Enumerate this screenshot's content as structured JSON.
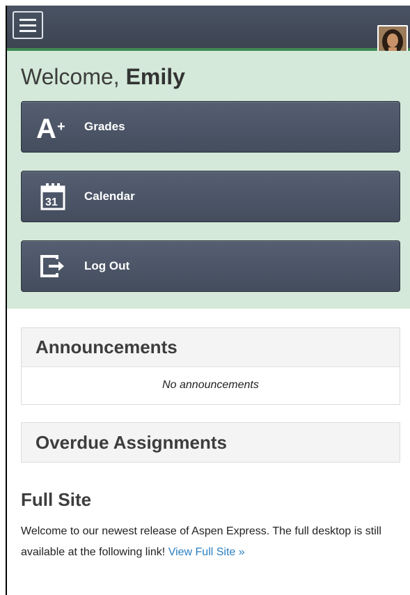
{
  "header": {
    "menu_icon": "hamburger-menu-icon",
    "avatar_icon": "user-avatar"
  },
  "welcome": {
    "greeting": "Welcome,",
    "name": "Emily"
  },
  "nav": [
    {
      "label": "Grades",
      "icon": "grade-a-plus-icon"
    },
    {
      "label": "Calendar",
      "icon": "calendar-icon"
    },
    {
      "label": "Log Out",
      "icon": "log-out-icon"
    }
  ],
  "announcements": {
    "title": "Announcements",
    "empty_text": "No announcements"
  },
  "overdue": {
    "title": "Overdue Assignments"
  },
  "full_site": {
    "title": "Full Site",
    "text": "Welcome to our newest release of Aspen Express. The full desktop is still available at the following link!",
    "link": "View Full Site »"
  },
  "colors": {
    "topbar": "#444d5b",
    "accent_green": "#3f8a52",
    "welcome_bg": "#d4e9d9",
    "link": "#2a7fc0"
  }
}
